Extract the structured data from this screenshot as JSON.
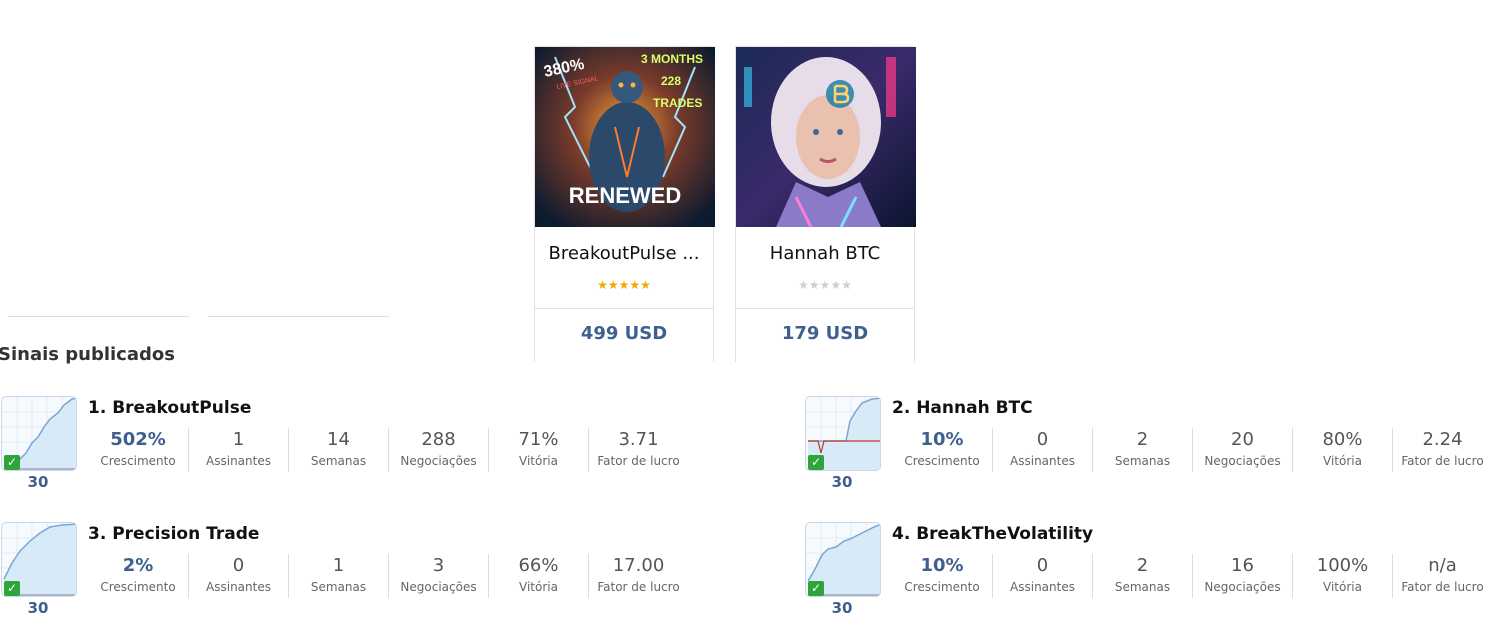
{
  "products": [
    {
      "name": "BreakoutPulse ...",
      "rating": 5,
      "price": "499 USD",
      "image_text": {
        "pct": "380%",
        "sub": "LIVE SIGNAL",
        "months": "3 MONTHS",
        "count": "228",
        "trades": "TRADES",
        "banner": "RENEWED"
      }
    },
    {
      "name": "Hannah BTC",
      "rating": 0,
      "price": "179 USD"
    }
  ],
  "section_title": "Sinais publicados",
  "labels": {
    "growth": "Crescimento",
    "subscribers": "Assinantes",
    "weeks": "Semanas",
    "trades": "Negociações",
    "win": "Vitória",
    "profit_factor": "Fator de lucro"
  },
  "signals": [
    {
      "name": "1. BreakoutPulse",
      "growth": "502%",
      "subscribers": "1",
      "weeks": "14",
      "trades": "288",
      "win": "71%",
      "profit_factor": "3.71",
      "period": "30"
    },
    {
      "name": "2. Hannah BTC",
      "growth": "10%",
      "subscribers": "0",
      "weeks": "2",
      "trades": "20",
      "win": "80%",
      "profit_factor": "2.24",
      "period": "30"
    },
    {
      "name": "3. Precision Trade",
      "growth": "2%",
      "subscribers": "0",
      "weeks": "1",
      "trades": "3",
      "win": "66%",
      "profit_factor": "17.00",
      "period": "30"
    },
    {
      "name": "4. BreakTheVolatility",
      "growth": "10%",
      "subscribers": "0",
      "weeks": "2",
      "trades": "16",
      "win": "100%",
      "profit_factor": "n/a",
      "period": "30"
    }
  ],
  "colors": {
    "accent": "#3f5f8f",
    "star": "#f0a800",
    "check": "#2ea43a",
    "chart_line": "#7aa6d6",
    "chart_fill": "#d8e9f8",
    "drawdown": "#c0392b"
  }
}
